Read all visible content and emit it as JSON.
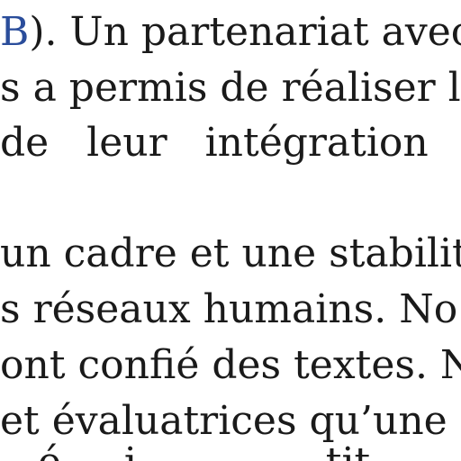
{
  "document": {
    "lines": [
      {
        "link": "B",
        "rest": "). Un partenariat avec"
      },
      {
        "text": "s a permis de réaliser l"
      },
      {
        "text": "de   leur   intégration"
      },
      {
        "text": "un cadre et une stabilit"
      },
      {
        "text": "s réseaux humains. No"
      },
      {
        "text": "ont confié des textes. N"
      },
      {
        "text": "et évaluatrices qu’une l"
      },
      {
        "text": "   é     i               tit"
      }
    ],
    "colors": {
      "text": "#1a1a1a",
      "link": "#2a4d9b",
      "background": "#ffffff"
    }
  }
}
